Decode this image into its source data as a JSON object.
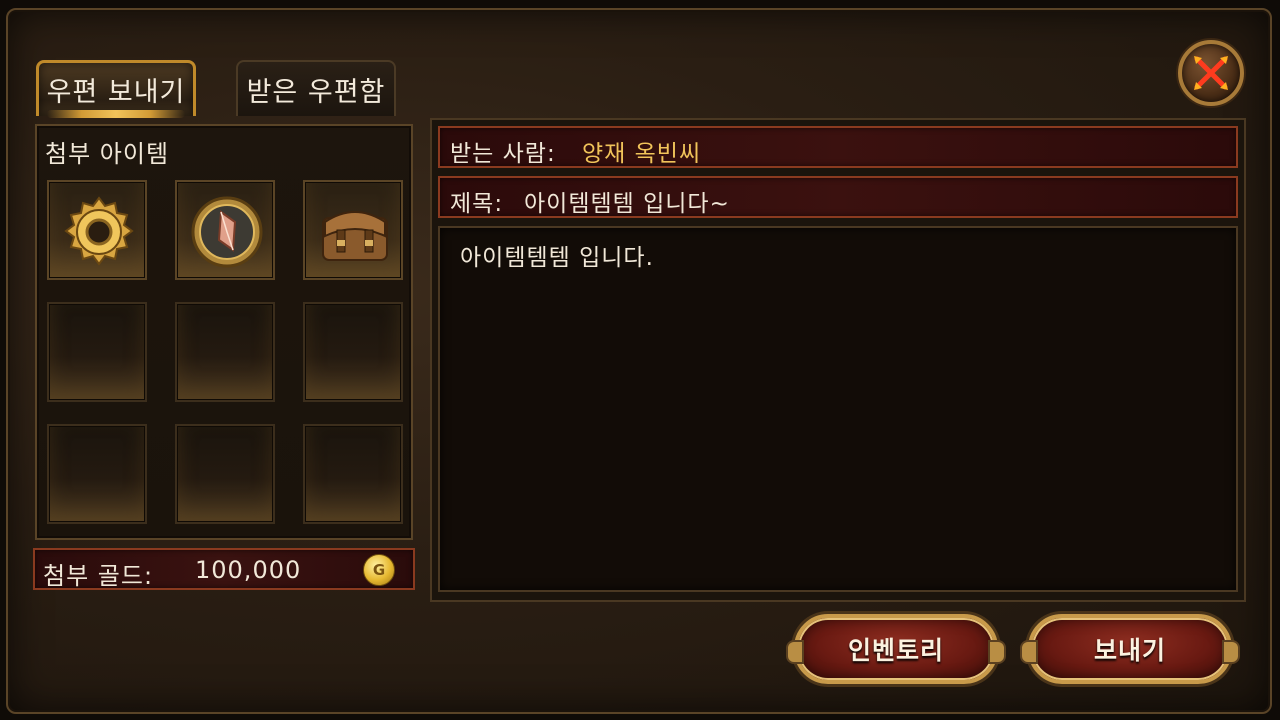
{
  "tabs": {
    "send": "우편 보내기",
    "inbox": "받은 우편함"
  },
  "attachments": {
    "title": "첨부 아이템",
    "slots": [
      {
        "item": "gear-ring-icon"
      },
      {
        "item": "crystal-medallion-icon"
      },
      {
        "item": "leather-bag-icon"
      },
      {
        "item": ""
      },
      {
        "item": ""
      },
      {
        "item": ""
      },
      {
        "item": ""
      },
      {
        "item": ""
      },
      {
        "item": ""
      }
    ]
  },
  "gold": {
    "label": "첨부 골드:",
    "value": "100,000",
    "coin_letter": "G"
  },
  "mail": {
    "recipient_label": "받는 사람:",
    "recipient_value": "양재 옥빈씨",
    "subject_label": "제목:",
    "subject_value": "아이템템템 입니다~",
    "body": "아이템템템 입니다."
  },
  "buttons": {
    "inventory": "인벤토리",
    "send": "보내기"
  },
  "colors": {
    "accent_gold": "#f1c45a",
    "frame_border": "#5a4427",
    "button_red": "#6a1a12"
  }
}
